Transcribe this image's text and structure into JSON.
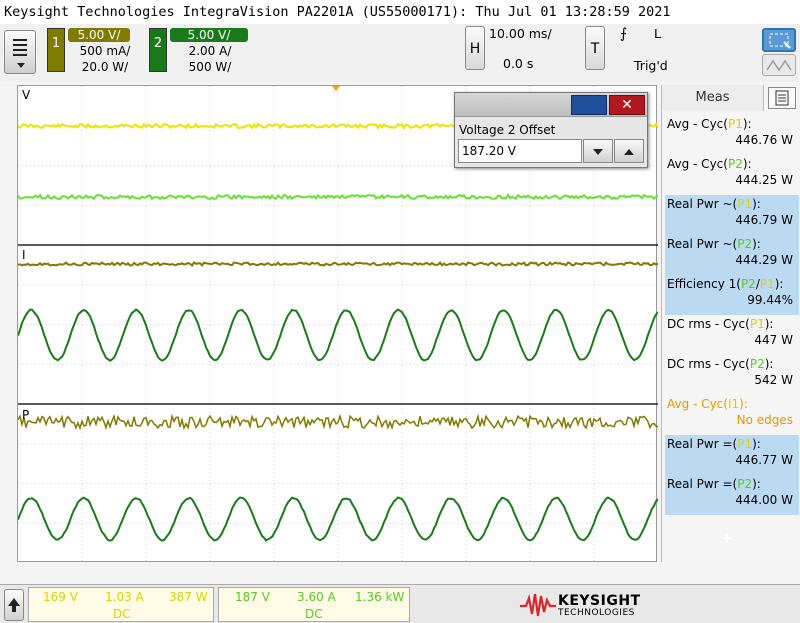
{
  "title_bar": "Keysight Technologies IntegraVision PA2201A (US55000171): Thu Jul 01 13:28:59 2021",
  "channel1": {
    "number": "1",
    "scale": "5.00 V/",
    "current": "500 mA/",
    "power": "20.0 W/",
    "color": "#7f7f00"
  },
  "channel2": {
    "number": "2",
    "scale": "5.00 V/",
    "current": "2.00 A/",
    "power": "500 W/",
    "color": "#1e7b1e"
  },
  "horizontal": {
    "label": "H",
    "timebase": "10.00 ms/",
    "delay": "0.0 s"
  },
  "trigger": {
    "label": "T",
    "level": "L",
    "status": "Trig'd"
  },
  "grid_labels": {
    "voltage": "V",
    "current": "I",
    "power": "P"
  },
  "dialog": {
    "title": "Voltage 2 Offset",
    "value": "187.20 V"
  },
  "meas_panel": {
    "tab": "Meas",
    "items": [
      {
        "name_prefix": "Avg - Cyc(",
        "source": "P1",
        "name_suffix": "):",
        "value": "446.76 W",
        "selected": false
      },
      {
        "name_prefix": "Avg - Cyc(",
        "source": "P2",
        "name_suffix": "):",
        "value": "444.25 W",
        "selected": false
      },
      {
        "name_prefix": "Real Pwr  ",
        "source": "P1",
        "name_suffix": "):",
        "value": "446.79 W",
        "selected": true,
        "glyph": "~("
      },
      {
        "name_prefix": "Real Pwr  ",
        "source": "P2",
        "name_suffix": "):",
        "value": "444.29 W",
        "selected": true,
        "glyph": "~("
      },
      {
        "name_prefix": "Efficiency 1(",
        "source": "P2/P1",
        "name_suffix": "):",
        "value": "99.44%",
        "selected": true
      },
      {
        "name_prefix": "DC rms - Cyc(",
        "source": "P1",
        "name_suffix": "):",
        "value": "447 W",
        "selected": false
      },
      {
        "name_prefix": "DC rms - Cyc(",
        "source": "P2",
        "name_suffix": "):",
        "value": "542 W",
        "selected": false
      },
      {
        "name_prefix": "Avg - Cyc(",
        "source": "I1",
        "name_suffix": "):",
        "value": "No edges",
        "selected": false,
        "warning": true
      },
      {
        "name_prefix": "Real Pwr  ",
        "source": "P1",
        "name_suffix": "):",
        "value": "446.77 W",
        "selected": true,
        "glyph": "=("
      },
      {
        "name_prefix": "Real Pwr  ",
        "source": "P2",
        "name_suffix": "):",
        "value": "444.00 W",
        "selected": true,
        "glyph": "=("
      }
    ],
    "add_label": "+"
  },
  "bottom": {
    "ch1": {
      "voltage": "169 V",
      "current": "1.03 A",
      "power": "387 W",
      "coupling": "DC"
    },
    "ch2": {
      "voltage": "187 V",
      "current": "3.60 A",
      "power": "1.36 kW",
      "coupling": "DC"
    },
    "brand": "KEYSIGHT",
    "brand_sub": "TECHNOLOGIES"
  },
  "colors": {
    "ch1": "#e6e600",
    "ch2": "#66e033",
    "ch1_dark": "#7f7a00",
    "ch2_dark": "#1a7a1a",
    "selected_row": "#bcd9f2",
    "warning": "#e09a00"
  }
}
